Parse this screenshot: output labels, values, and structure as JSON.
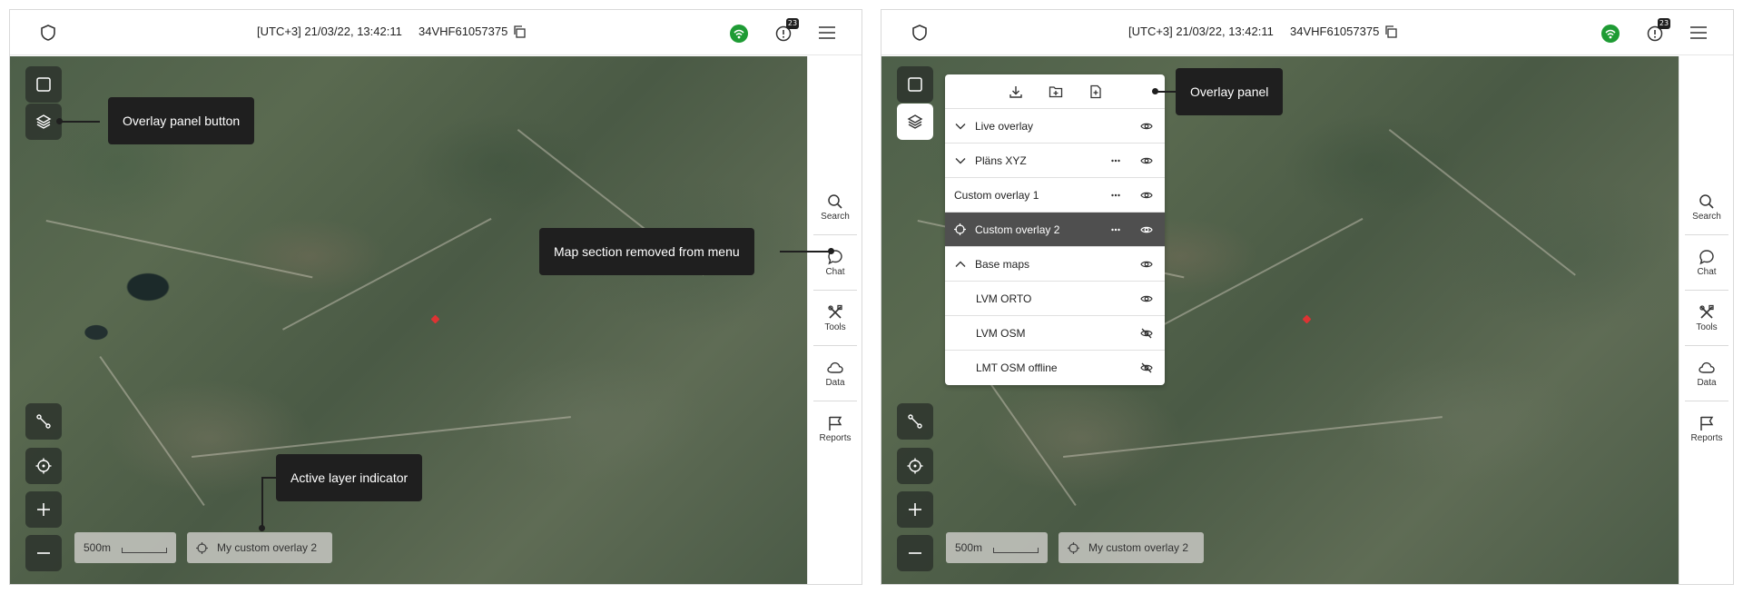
{
  "top_bar": {
    "datetime": "[UTC+3] 21/03/22, 13:42:11",
    "device_id": "34VHF61057375",
    "notification_count": "23"
  },
  "sidebar": [
    {
      "label": "Search",
      "icon": "search-icon"
    },
    {
      "label": "Chat",
      "icon": "chat-icon"
    },
    {
      "label": "Tools",
      "icon": "tools-icon"
    },
    {
      "label": "Data",
      "icon": "cloud-icon"
    },
    {
      "label": "Reports",
      "icon": "flag-icon"
    }
  ],
  "map": {
    "scale_label": "500m",
    "active_layer": "My custom overlay 2"
  },
  "callouts": {
    "overlay_panel_button": "Overlay panel button",
    "map_section_removed": "Map section removed from menu",
    "active_layer_indicator": "Active layer indicator",
    "overlay_panel": "Overlay panel"
  },
  "overlay_panel": {
    "rows": [
      {
        "label": "Live overlay",
        "expanded": false,
        "visible": true
      },
      {
        "label": "Pläns XYZ",
        "expanded": false,
        "visible": true
      },
      {
        "label": "Custom overlay 1",
        "visible": true
      },
      {
        "label": "Custom overlay 2",
        "active": true,
        "visible": true
      },
      {
        "label": "Base maps",
        "expanded": true,
        "visible": true
      },
      {
        "label": "LVM ORTO",
        "visible": true
      },
      {
        "label": "LVM OSM",
        "visible": false
      },
      {
        "label": "LMT OSM offline",
        "visible": false
      }
    ]
  },
  "colors": {
    "wifi": "#1e9b34",
    "callout": "#1f1f1f",
    "selected_row": "#4f4f4f"
  }
}
